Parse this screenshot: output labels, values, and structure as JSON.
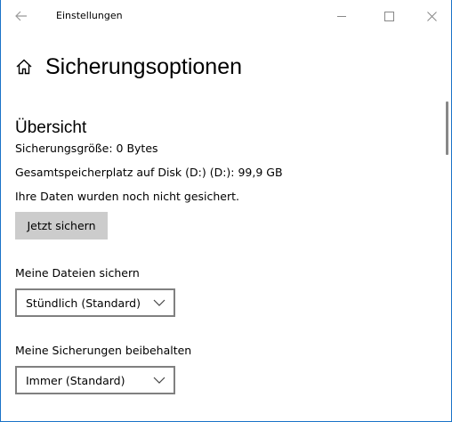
{
  "window": {
    "title": "Einstellungen"
  },
  "header": {
    "title": "Sicherungsoptionen"
  },
  "overview": {
    "heading": "Übersicht",
    "backup_size": "Sicherungsgröße: 0 Bytes",
    "total_space": "Gesamtspeicherplatz auf Disk (D:) (D:): 99,9 GB",
    "status": "Ihre Daten wurden noch nicht gesichert.",
    "backup_now_label": "Jetzt sichern"
  },
  "backup_frequency": {
    "label": "Meine Dateien sichern",
    "selected": "Stündlich (Standard)"
  },
  "retention": {
    "label": "Meine Sicherungen beibehalten",
    "selected": "Immer (Standard)"
  },
  "icons": {
    "back": "back-arrow-icon",
    "home": "home-icon",
    "minimize": "minimize-icon",
    "maximize": "maximize-icon",
    "close": "close-icon",
    "dropdown": "chevron-down-icon"
  },
  "colors": {
    "window_border": "#1a73c8",
    "button_bg": "#cccccc",
    "dropdown_border": "#808080",
    "scrollbar": "#888888"
  }
}
